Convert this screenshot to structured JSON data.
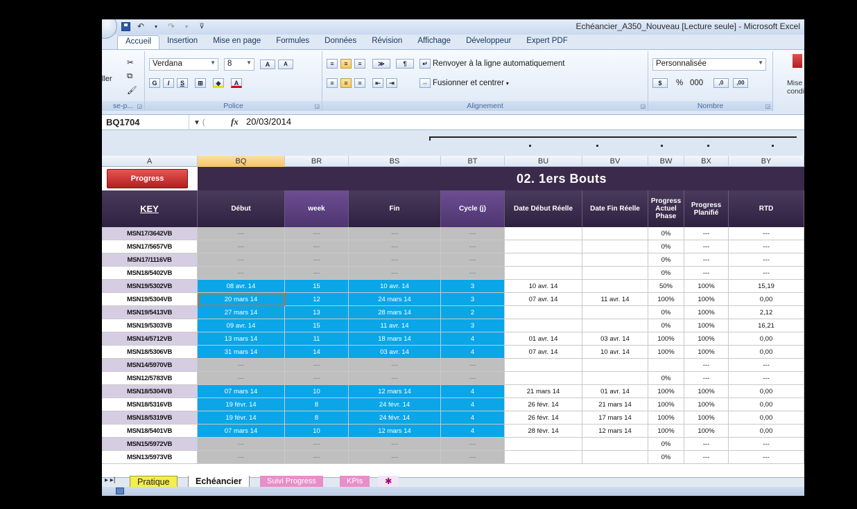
{
  "window": {
    "title": "Echéancier_A350_Nouveau  [Lecture seule] - Microsoft Excel"
  },
  "tabs": [
    "Accueil",
    "Insertion",
    "Mise en page",
    "Formules",
    "Données",
    "Révision",
    "Affichage",
    "Développeur",
    "Expert PDF"
  ],
  "ribbon": {
    "clipboard": {
      "paste_label": "ller",
      "group_label": "se-p..."
    },
    "font": {
      "name": "Verdana",
      "size": "8",
      "group_label": "Police",
      "bold": "G",
      "italic": "I",
      "underline": "S",
      "grow": "A",
      "shrink": "A",
      "color_a": "A"
    },
    "alignment": {
      "wrap": "Renvoyer à la ligne automatiquement",
      "merge": "Fusionner et centrer",
      "group_label": "Alignement"
    },
    "number": {
      "format": "Personnalisée",
      "percent": "%",
      "thousands": "000",
      "inc": ",0",
      "dec": ",00",
      "group_label": "Nombre"
    },
    "styles": {
      "cond_1": "Mise e",
      "cond_2": "conditio"
    }
  },
  "formula_bar": {
    "namebox": "BQ1704",
    "fx": "fx",
    "value": "20/03/2014"
  },
  "columns": [
    {
      "id": "A",
      "selected": false
    },
    {
      "id": "BQ",
      "selected": true
    },
    {
      "id": "BR",
      "selected": false
    },
    {
      "id": "BS",
      "selected": false
    },
    {
      "id": "BT",
      "selected": false
    },
    {
      "id": "BU",
      "selected": false
    },
    {
      "id": "BV",
      "selected": false
    },
    {
      "id": "BW",
      "selected": false
    },
    {
      "id": "BX",
      "selected": false
    },
    {
      "id": "BY",
      "selected": false
    }
  ],
  "section_title": "02. 1ers Bouts",
  "progress_button": "Progress",
  "headers": [
    "KEY",
    "Début",
    "week",
    "Fin",
    "Cycle (j)",
    "Date Début Réelle",
    "Date Fin Réelle",
    "Progress Actuel Phase",
    "Progress Planifié",
    "RTD"
  ],
  "rows": [
    {
      "key": "MSN17/3642VB",
      "keycolor": "lav",
      "blue": false,
      "debut": "---",
      "week": "---",
      "fin": "---",
      "cycle": "---",
      "ddr": "",
      "dfr": "",
      "pap": "0%",
      "pp": "---",
      "rtd": "---"
    },
    {
      "key": "MSN17/5657VB",
      "keycolor": "wht",
      "blue": false,
      "debut": "---",
      "week": "---",
      "fin": "---",
      "cycle": "---",
      "ddr": "",
      "dfr": "",
      "pap": "0%",
      "pp": "---",
      "rtd": "---"
    },
    {
      "key": "MSN17/1116VB",
      "keycolor": "lav",
      "blue": false,
      "debut": "---",
      "week": "---",
      "fin": "---",
      "cycle": "---",
      "ddr": "",
      "dfr": "",
      "pap": "0%",
      "pp": "---",
      "rtd": "---"
    },
    {
      "key": "MSN18/5402VB",
      "keycolor": "wht",
      "blue": false,
      "debut": "---",
      "week": "---",
      "fin": "---",
      "cycle": "---",
      "ddr": "",
      "dfr": "",
      "pap": "0%",
      "pp": "---",
      "rtd": "---"
    },
    {
      "key": "MSN19/5302VB",
      "keycolor": "lav",
      "blue": true,
      "debut": "08 avr. 14",
      "week": "15",
      "fin": "10 avr. 14",
      "cycle": "3",
      "ddr": "10 avr. 14",
      "dfr": "",
      "pap": "50%",
      "pp": "100%",
      "rtd": "15,19"
    },
    {
      "key": "MSN19/5304VB",
      "keycolor": "wht",
      "blue": true,
      "selected": true,
      "debut": "20 mars 14",
      "week": "12",
      "fin": "24 mars 14",
      "cycle": "3",
      "ddr": "07 avr. 14",
      "dfr": "11 avr. 14",
      "pap": "100%",
      "pp": "100%",
      "rtd": "0,00"
    },
    {
      "key": "MSN19/5413VB",
      "keycolor": "lav",
      "blue": true,
      "debut": "27 mars 14",
      "week": "13",
      "fin": "28 mars 14",
      "cycle": "2",
      "ddr": "",
      "dfr": "",
      "pap": "0%",
      "pp": "100%",
      "rtd": "2,12"
    },
    {
      "key": "MSN19/5303VB",
      "keycolor": "wht",
      "blue": true,
      "debut": "09 avr. 14",
      "week": "15",
      "fin": "11 avr. 14",
      "cycle": "3",
      "ddr": "",
      "dfr": "",
      "pap": "0%",
      "pp": "100%",
      "rtd": "16,21"
    },
    {
      "key": "MSN14/5712VB",
      "keycolor": "lav",
      "blue": true,
      "debut": "13 mars 14",
      "week": "11",
      "fin": "18 mars 14",
      "cycle": "4",
      "ddr": "01 avr. 14",
      "dfr": "03 avr. 14",
      "pap": "100%",
      "pp": "100%",
      "rtd": "0,00"
    },
    {
      "key": "MSN18/5306VB",
      "keycolor": "wht",
      "blue": true,
      "debut": "31 mars 14",
      "week": "14",
      "fin": "03 avr. 14",
      "cycle": "4",
      "ddr": "07 avr. 14",
      "dfr": "10 avr. 14",
      "pap": "100%",
      "pp": "100%",
      "rtd": "0,00"
    },
    {
      "key": "MSN14/5970VB",
      "keycolor": "lav",
      "blue": false,
      "debut": "---",
      "week": "---",
      "fin": "---",
      "cycle": "---",
      "ddr": "",
      "dfr": "",
      "pap": "",
      "pp": "---",
      "rtd": "---"
    },
    {
      "key": "MSN12/5783VB",
      "keycolor": "wht",
      "blue": false,
      "debut": "---",
      "week": "---",
      "fin": "---",
      "cycle": "---",
      "ddr": "",
      "dfr": "",
      "pap": "0%",
      "pp": "---",
      "rtd": "---"
    },
    {
      "key": "MSN18/5304VB",
      "keycolor": "lav",
      "blue": true,
      "debut": "07 mars 14",
      "week": "10",
      "fin": "12 mars 14",
      "cycle": "4",
      "ddr": "21 mars 14",
      "dfr": "01 avr. 14",
      "pap": "100%",
      "pp": "100%",
      "rtd": "0,00"
    },
    {
      "key": "MSN18/5316VB",
      "keycolor": "wht",
      "blue": true,
      "debut": "19 févr. 14",
      "week": "8",
      "fin": "24 févr. 14",
      "cycle": "4",
      "ddr": "26 févr. 14",
      "dfr": "21 mars 14",
      "pap": "100%",
      "pp": "100%",
      "rtd": "0,00"
    },
    {
      "key": "MSN18/5319VB",
      "keycolor": "lav",
      "blue": true,
      "debut": "19 févr. 14",
      "week": "8",
      "fin": "24 févr. 14",
      "cycle": "4",
      "ddr": "26 févr. 14",
      "dfr": "17 mars 14",
      "pap": "100%",
      "pp": "100%",
      "rtd": "0,00"
    },
    {
      "key": "MSN18/5401VB",
      "keycolor": "wht",
      "blue": true,
      "debut": "07 mars 14",
      "week": "10",
      "fin": "12 mars 14",
      "cycle": "4",
      "ddr": "28 févr. 14",
      "dfr": "12 mars 14",
      "pap": "100%",
      "pp": "100%",
      "rtd": "0,00"
    },
    {
      "key": "MSN15/5972VB",
      "keycolor": "lav",
      "blue": false,
      "debut": "---",
      "week": "---",
      "fin": "---",
      "cycle": "---",
      "ddr": "",
      "dfr": "",
      "pap": "0%",
      "pp": "---",
      "rtd": "---"
    },
    {
      "key": "MSN13/5973VB",
      "keycolor": "wht",
      "blue": false,
      "debut": "---",
      "week": "---",
      "fin": "---",
      "cycle": "---",
      "ddr": "",
      "dfr": "",
      "pap": "0%",
      "pp": "---",
      "rtd": "---"
    }
  ],
  "sheet_tabs": [
    "Pratique",
    "Echéancier",
    "Suivi Progress",
    "KPIs"
  ],
  "colors": {
    "blue_cell": "#0aa6e8",
    "gray_cell": "#bfbfbf",
    "lavender_key": "#d6cde3",
    "header_dark": "#3b2a4b",
    "progress_button": "#c62b2b"
  }
}
